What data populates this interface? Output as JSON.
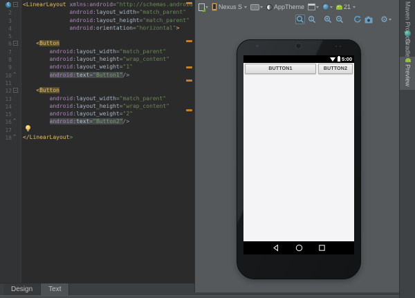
{
  "editor": {
    "lines": [
      {
        "num": 1,
        "gutter": "class fold",
        "segs": [
          [
            "tag",
            "<LinearLayout"
          ],
          [
            "pl",
            " "
          ],
          [
            "ns",
            "xmlns:android"
          ],
          [
            "pl",
            "="
          ],
          [
            "str",
            "\"http://schemas.android.c"
          ]
        ]
      },
      {
        "num": 2,
        "segs": [
          [
            "pl",
            "              "
          ],
          [
            "ns",
            "android:"
          ],
          [
            "attr",
            "layout_width"
          ],
          [
            "pl",
            "="
          ],
          [
            "str",
            "\"match_parent\""
          ]
        ]
      },
      {
        "num": 3,
        "segs": [
          [
            "pl",
            "              "
          ],
          [
            "ns",
            "android:"
          ],
          [
            "attr",
            "layout_height"
          ],
          [
            "pl",
            "="
          ],
          [
            "str",
            "\"match_parent\""
          ]
        ]
      },
      {
        "num": 4,
        "segs": [
          [
            "pl",
            "              "
          ],
          [
            "ns",
            "android:"
          ],
          [
            "attr",
            "orientation"
          ],
          [
            "pl",
            "="
          ],
          [
            "str",
            "\"horizontal\""
          ],
          [
            "tag",
            ">"
          ]
        ]
      },
      {
        "num": 5,
        "segs": []
      },
      {
        "num": 6,
        "gutter": "fold",
        "segs": [
          [
            "pl",
            "    "
          ],
          [
            "tag",
            "<"
          ],
          [
            "taghl",
            "Button"
          ]
        ]
      },
      {
        "num": 7,
        "segs": [
          [
            "pl",
            "        "
          ],
          [
            "ns",
            "android:"
          ],
          [
            "attr",
            "layout_width"
          ],
          [
            "pl",
            "="
          ],
          [
            "str",
            "\"match_parent\""
          ]
        ]
      },
      {
        "num": 8,
        "segs": [
          [
            "pl",
            "        "
          ],
          [
            "ns",
            "android:"
          ],
          [
            "attr",
            "layout_height"
          ],
          [
            "pl",
            "="
          ],
          [
            "str",
            "\"wrap_content\""
          ]
        ]
      },
      {
        "num": 9,
        "segs": [
          [
            "pl",
            "        "
          ],
          [
            "ns",
            "android:"
          ],
          [
            "attr",
            "layout_weight"
          ],
          [
            "pl",
            "="
          ],
          [
            "str",
            "\"1\""
          ]
        ]
      },
      {
        "num": 10,
        "gutter": "end",
        "segs": [
          [
            "pl",
            "        "
          ],
          [
            "nsh",
            "android:"
          ],
          [
            "attrh",
            "text"
          ],
          [
            "plh",
            "="
          ],
          [
            "strh",
            "\"Button1\""
          ],
          [
            "pl",
            "/>"
          ]
        ]
      },
      {
        "num": 11,
        "segs": []
      },
      {
        "num": 12,
        "gutter": "fold",
        "segs": [
          [
            "pl",
            "    "
          ],
          [
            "tag",
            "<"
          ],
          [
            "taghl",
            "Button"
          ]
        ]
      },
      {
        "num": 13,
        "segs": [
          [
            "pl",
            "        "
          ],
          [
            "ns",
            "android:"
          ],
          [
            "attr",
            "layout_width"
          ],
          [
            "pl",
            "="
          ],
          [
            "str",
            "\"match_parent\""
          ]
        ]
      },
      {
        "num": 14,
        "segs": [
          [
            "pl",
            "        "
          ],
          [
            "ns",
            "android:"
          ],
          [
            "attr",
            "layout_height"
          ],
          [
            "pl",
            "="
          ],
          [
            "str",
            "\"wrap_content\""
          ]
        ]
      },
      {
        "num": 15,
        "segs": [
          [
            "pl",
            "        "
          ],
          [
            "ns",
            "android:"
          ],
          [
            "attr",
            "layout_weight"
          ],
          [
            "pl",
            "="
          ],
          [
            "str",
            "\"2\""
          ]
        ]
      },
      {
        "num": 16,
        "gutter": "end",
        "segs": [
          [
            "pl",
            "        "
          ],
          [
            "nsh",
            "android:"
          ],
          [
            "attrh",
            "text"
          ],
          [
            "plh",
            "="
          ],
          [
            "strh",
            "\"Button2\""
          ],
          [
            "pl",
            "/>"
          ]
        ]
      },
      {
        "num": 17,
        "segs": []
      },
      {
        "num": 18,
        "gutter": "end",
        "segs": [
          [
            "tag",
            "</LinearLayout"
          ],
          [
            "grn",
            ">"
          ]
        ]
      }
    ]
  },
  "bottom_tabs": {
    "design": "Design",
    "text": "Text"
  },
  "toolbar": {
    "device_label": "Nexus S",
    "theme_label": "AppTheme",
    "api_label": "21"
  },
  "phone": {
    "time": "5:00",
    "buttons": [
      "BUTTON1",
      "BUTTON2"
    ]
  },
  "right_strip": {
    "maven": "Maven Projects",
    "gradle": "Gradle",
    "preview": "Preview"
  },
  "colors": {
    "editor_bg": "#2B2B2B",
    "pane_bg": "#55595B",
    "tag": "#E8BF6A",
    "namespace": "#AE8ABE",
    "string": "#6A8759",
    "stripe_mark": "#C77E28",
    "android_green": "#97C13C"
  }
}
